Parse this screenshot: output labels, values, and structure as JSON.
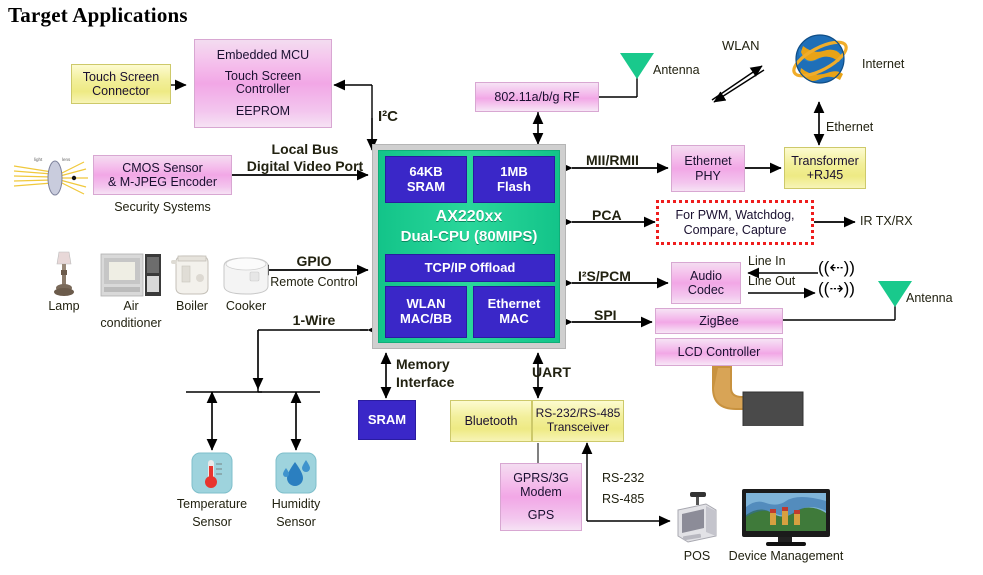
{
  "title": "Target Applications",
  "chip": {
    "name": "AX220xx",
    "subtitle": "Dual-CPU (80MIPS)",
    "blocks": [
      {
        "label": "64KB\nSRAM",
        "line1": "64KB",
        "line2": "SRAM"
      },
      {
        "label": "1MB\nFlash",
        "line1": "1MB",
        "line2": "Flash"
      },
      {
        "label": "TCP/IP Offload"
      },
      {
        "line1": "WLAN",
        "line2": "MAC/BB"
      },
      {
        "line1": "Ethernet",
        "line2": "MAC"
      }
    ],
    "colors": {
      "body": "#17c98c",
      "sub_block": "#3a27c8",
      "frame": "#cfcfcf"
    }
  },
  "blocks": {
    "touch_screen_connector": {
      "line1": "Touch Screen",
      "line2": "Connector",
      "color": "#eeea84"
    },
    "embedded_mcu": {
      "line1": "Embedded  MCU",
      "line2": "Touch Screen",
      "line3": "Controller",
      "line4": "EEPROM",
      "color": "#f2a7e6"
    },
    "cmos_sensor": {
      "line1": "CMOS Sensor",
      "line2": "& M-JPEG Encoder",
      "caption": "Security Systems",
      "color": "#f2a7e6"
    },
    "wifi_rf": {
      "label": "802.11a/b/g RF",
      "color": "#f2a7e6"
    },
    "ethernet_phy": {
      "line1": "Ethernet",
      "line2": "PHY",
      "color": "#f2a7e6"
    },
    "transformer": {
      "line1": "Transformer",
      "line2": "+RJ45",
      "color": "#eeea84"
    },
    "pca_periph": {
      "line1": "For PWM, Watchdog,",
      "line2": "Compare, Capture",
      "border_color": "#ef1d1d"
    },
    "audio_codec": {
      "line1": "Audio",
      "line2": "Codec",
      "color": "#f2a7e6"
    },
    "zigbee": {
      "label": "ZigBee",
      "color": "#f2a7e6"
    },
    "lcd_controller": {
      "label": "LCD Controller",
      "color": "#f2a7e6"
    },
    "sram_external": {
      "label": "SRAM",
      "color": "#3a27c8"
    },
    "bluetooth": {
      "label": "Bluetooth",
      "color": "#eeea84"
    },
    "rs_transceiver": {
      "line1": "RS-232/RS-485",
      "line2": "Transceiver",
      "color": "#eeea84"
    },
    "gprs_modem": {
      "line1": "GPRS/3G",
      "line2": "Modem",
      "line3": "GPS",
      "color": "#f2a7e6"
    }
  },
  "bus_labels": {
    "i2c": "I²C",
    "local_bus": "Local Bus",
    "digital_video_port": "Digital Video Port",
    "mii_rmii": "MII/RMII",
    "pca": "PCA",
    "i2s_pcm": "I²S/PCM",
    "spi": "SPI",
    "gpio": "GPIO",
    "remote_control": "Remote Control",
    "one_wire": "1-Wire",
    "memory_interface_l1": "Memory",
    "memory_interface_l2": "Interface",
    "uart": "UART",
    "rs232": "RS-232",
    "rs485": "RS-485",
    "ethernet": "Ethernet",
    "wlan": "WLAN",
    "ir_txrx": "IR TX/RX",
    "line_in": "Line In",
    "line_out": "Line Out"
  },
  "icons": {
    "antenna_top": "Antenna",
    "antenna_right": "Antenna",
    "internet": "Internet",
    "lamp": "Lamp",
    "air_conditioner_l1": "Air",
    "air_conditioner_l2": "conditioner",
    "boiler": "Boiler",
    "cooker": "Cooker",
    "temperature_sensor_l1": "Temperature",
    "temperature_sensor_l2": "Sensor",
    "humidity_sensor_l1": "Humidity",
    "humidity_sensor_l2": "Sensor",
    "pos": "POS",
    "device_management": "Device Management"
  }
}
